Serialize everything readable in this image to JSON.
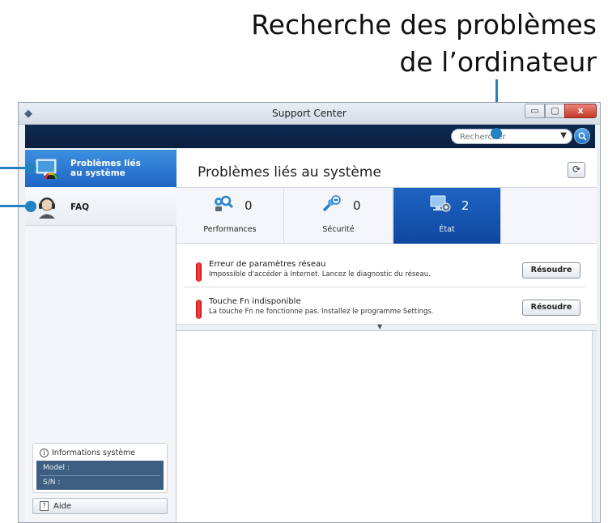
{
  "annotation": {
    "title_line1": "Recherche des problèmes",
    "title_line2": "de l’ordinateur",
    "accent_color": "#2282c2"
  },
  "window": {
    "title": "Support Center",
    "controls": {
      "minimize": "▭",
      "maximize": "▢",
      "close": "x"
    }
  },
  "search": {
    "placeholder": "Rechercher",
    "dropdown_icon": "triangle-down-icon",
    "button_icon": "magnifier-icon"
  },
  "sidebar": {
    "items": [
      {
        "label": "Problèmes liés au système",
        "icon": "monitor-gauge-icon",
        "active": true
      },
      {
        "label": "FAQ",
        "icon": "headset-agent-icon",
        "active": false
      }
    ],
    "system_info": {
      "heading": "Informations système",
      "model_label": "Model :",
      "sn_label": "S/N :"
    },
    "help_label": "Aide"
  },
  "main": {
    "title": "Problèmes liés au système",
    "refresh_icon": "refresh-icon",
    "tabs": [
      {
        "label": "Performances",
        "count": "0",
        "icon": "magnifier-gears-icon",
        "active": false
      },
      {
        "label": "Sécurité",
        "count": "0",
        "icon": "wrench-shield-icon",
        "active": false
      },
      {
        "label": "État",
        "count": "2",
        "icon": "monitor-gear-icon",
        "active": true
      }
    ],
    "issues": [
      {
        "title": "Erreur de paramètres réseau",
        "description": "Impossible d'accéder à Internet. Lancez le diagnostic du réseau.",
        "action": "Résoudre",
        "severity_color": "#d11111"
      },
      {
        "title": "Touche Fn indisponible",
        "description": "La touche Fn ne fonctionne pas. Installez le programme Settings.",
        "action": "Résoudre",
        "severity_color": "#d11111"
      }
    ]
  },
  "colors": {
    "active_blue": "#1f65c4",
    "header_navy": "#0a1f40",
    "sysinfo_panel": "#3e5f82"
  }
}
